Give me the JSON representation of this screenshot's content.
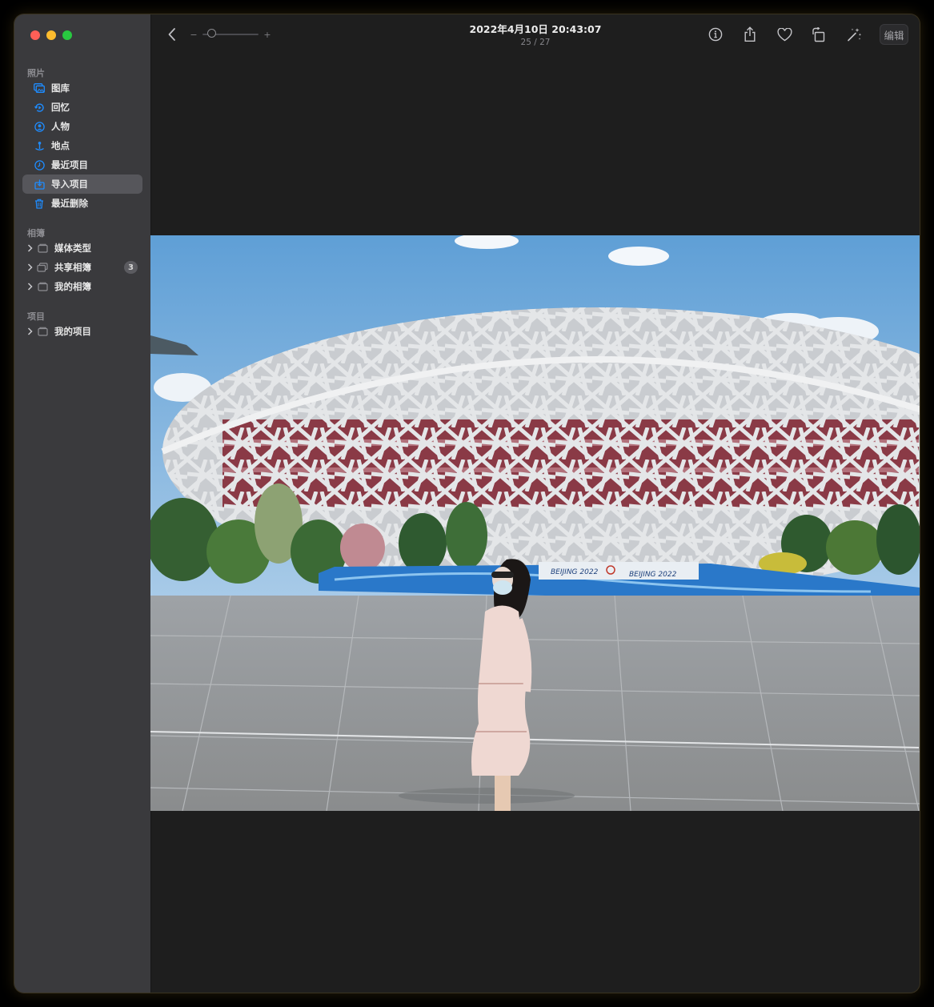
{
  "sidebar": {
    "photos_header": "照片",
    "photos_items": [
      {
        "label": "图库",
        "icon": "photo-library-icon"
      },
      {
        "label": "回忆",
        "icon": "memories-icon"
      },
      {
        "label": "人物",
        "icon": "people-icon"
      },
      {
        "label": "地点",
        "icon": "places-icon"
      },
      {
        "label": "最近项目",
        "icon": "recents-icon"
      },
      {
        "label": "导入项目",
        "icon": "imports-icon",
        "active": true
      },
      {
        "label": "最近删除",
        "icon": "trash-icon"
      }
    ],
    "albums_header": "相簿",
    "album_groups": [
      {
        "label": "媒体类型",
        "icon": "folder-icon"
      },
      {
        "label": "共享相簿",
        "icon": "shared-albums-icon",
        "badge": "3"
      },
      {
        "label": "我的相簿",
        "icon": "folder-icon"
      }
    ],
    "projects_header": "项目",
    "project_groups": [
      {
        "label": "我的项目",
        "icon": "folder-icon"
      }
    ]
  },
  "toolbar": {
    "zoom_minus": "−",
    "zoom_plus": "+",
    "title": "2022年4月10日 20:43:07",
    "subtitle": "25 / 27",
    "edit_label": "编辑"
  },
  "photo": {
    "banner_text_left": "BEIJING 2022",
    "banner_text_right": "BEIJING 2022"
  },
  "colors": {
    "accent": "#0a84ff",
    "sidebar_bg": "#3a3a3d",
    "content_bg": "#1e1e1e"
  }
}
